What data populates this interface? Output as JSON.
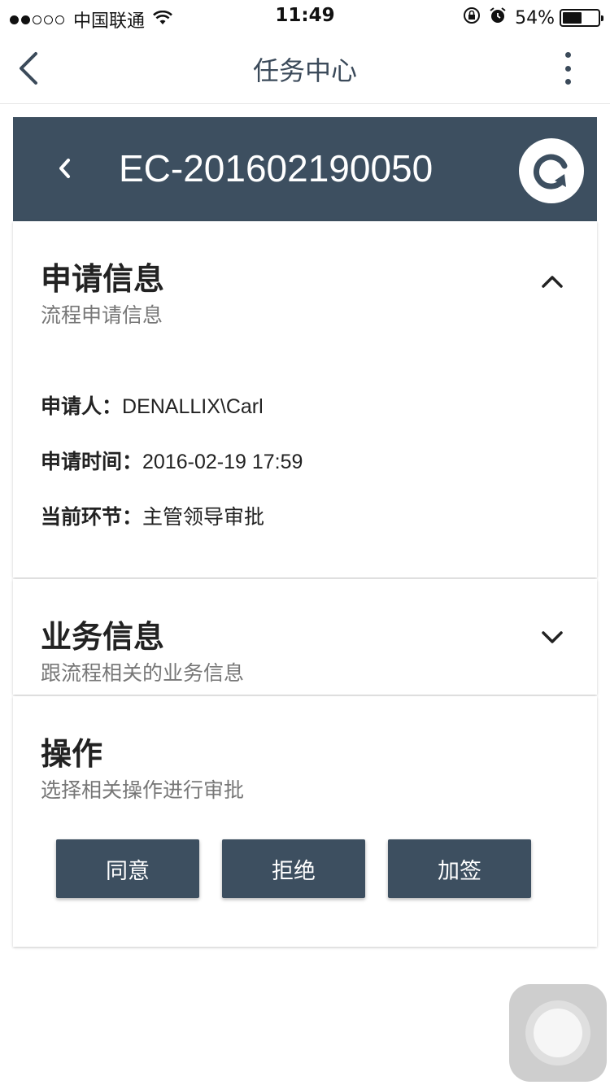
{
  "status_bar": {
    "carrier": "中国联通",
    "time": "11:49",
    "battery": "54%",
    "battery_level": 0.54
  },
  "nav": {
    "title": "任务中心"
  },
  "header": {
    "task_id": "EC-201602190050"
  },
  "apply_info": {
    "title": "申请信息",
    "subtitle": "流程申请信息",
    "rows": [
      {
        "label": "申请人：",
        "value": "DENALLIX\\Carl"
      },
      {
        "label": "申请时间：",
        "value": "2016-02-19 17:59"
      },
      {
        "label": "当前环节：",
        "value": "主管领导审批"
      }
    ]
  },
  "business_info": {
    "title": "业务信息",
    "subtitle": "跟流程相关的业务信息"
  },
  "operations": {
    "title": "操作",
    "subtitle": "选择相关操作进行审批",
    "buttons": [
      "同意",
      "拒绝",
      "加签"
    ]
  },
  "colors": {
    "primary": "#3d4f60",
    "nav_text": "#3b4a5a"
  }
}
